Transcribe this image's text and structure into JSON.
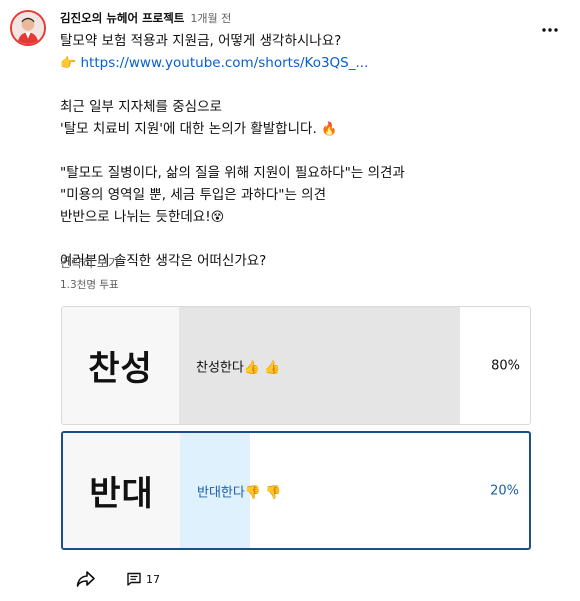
{
  "post": {
    "channel_name": "김진오의 뉴헤어 프로젝트",
    "time": "1개월 전",
    "lines": [
      {
        "text": "탈모약 보험 적용과 지원금, 어떻게 생각하시나요?",
        "emoji": ""
      },
      {
        "emoji": "👉",
        "link": "https://www.youtube.com/shorts/Ko3QS_..."
      },
      {
        "text": "최근 일부 지자체를 중심으로",
        "emoji": ""
      },
      {
        "text": "'탈모 치료비 지원'에 대한 논의가 활발합니다. ",
        "emoji": "🔥"
      },
      {
        "text": "\"탈모도 질병이다, 삶의 질을 위해 지원이 필요하다\"는 의견과",
        "emoji": ""
      },
      {
        "text": "\"미용의 영역일 뿐, 세금 투입은 과하다\"는 의견",
        "emoji": ""
      },
      {
        "text": "반반으로 나뉘는 듯한데요!",
        "emoji": "😵"
      },
      {
        "text": "여러분의 솔직한 생각은 어떠신가요?",
        "emoji": ""
      }
    ],
    "show_less": "간략히 보기",
    "vote_count": "1.3천명 투표"
  },
  "poll": {
    "options": [
      {
        "image_text": "찬성",
        "label": "찬성한다",
        "emoji": "👍 👍",
        "percent": 80,
        "percent_label": "80%",
        "selected": false,
        "fill_color": "#e5e5e5",
        "text_color": "#0f0f0f"
      },
      {
        "image_text": "반대",
        "label": "반대한다",
        "emoji": "👎 👎",
        "percent": 20,
        "percent_label": "20%",
        "selected": true,
        "fill_color": "#def1fc",
        "text_color": "#1a5fa8"
      }
    ]
  },
  "footer": {
    "comment_count": "17"
  },
  "icons": {
    "more": "more-vertical-icon",
    "share": "share-arrow-icon",
    "comment": "comment-icon"
  },
  "colors": {
    "link": "#065fd4",
    "selected_border": "#1a4f8a",
    "muted_text": "#606060"
  }
}
